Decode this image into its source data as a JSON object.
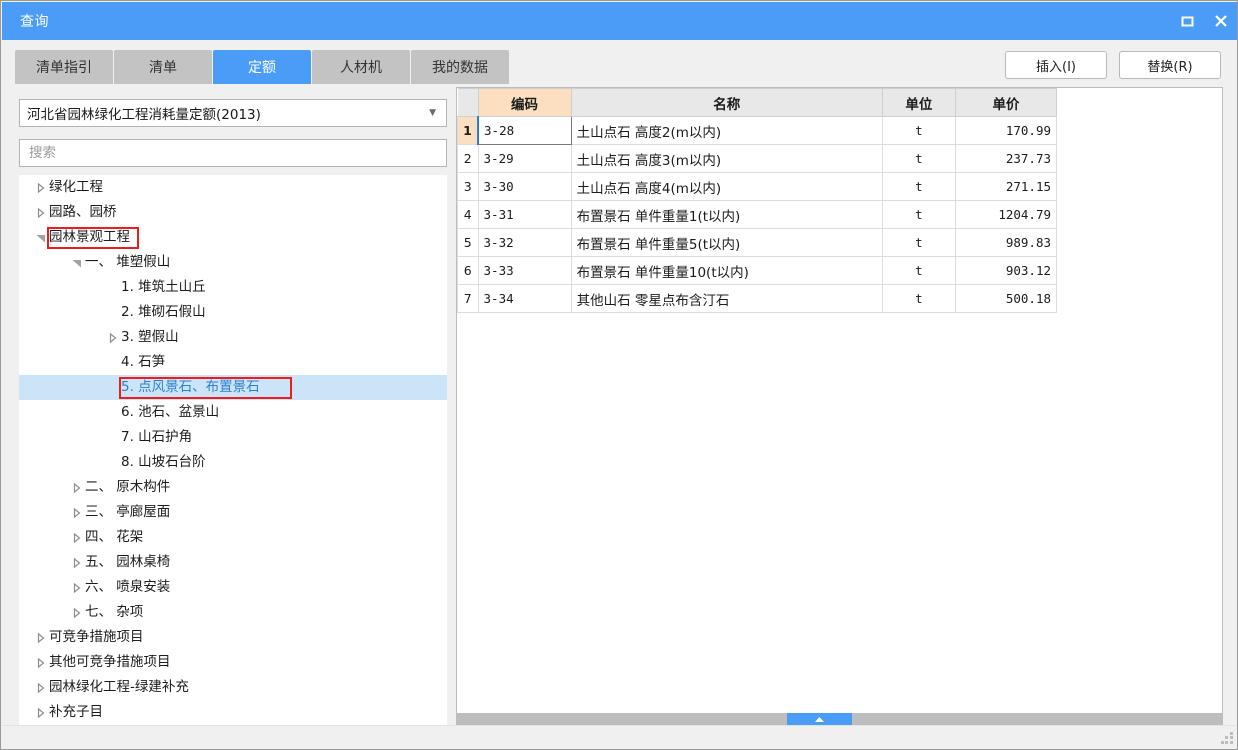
{
  "window": {
    "title": "查询",
    "controls": {
      "maximize": "□",
      "close": "✕"
    }
  },
  "tabs": [
    {
      "label": "清单指引",
      "active": false
    },
    {
      "label": "清单",
      "active": false
    },
    {
      "label": "定额",
      "active": true
    },
    {
      "label": "人材机",
      "active": false
    },
    {
      "label": "我的数据",
      "active": false
    }
  ],
  "actions": {
    "insert_label": "插入(I)",
    "replace_label": "替换(R)"
  },
  "library": {
    "selected": "河北省园林绿化工程消耗量定额(2013)",
    "dropdown_arrow": "▼"
  },
  "search": {
    "value": "",
    "placeholder": "搜索"
  },
  "tree": [
    {
      "label": "绿化工程",
      "indent": 0,
      "state": "collapsed",
      "selected": false,
      "boxed": false
    },
    {
      "label": "园路、园桥",
      "indent": 0,
      "state": "collapsed",
      "selected": false,
      "boxed": false
    },
    {
      "label": "园林景观工程",
      "indent": 0,
      "state": "expanded",
      "selected": false,
      "boxed": true
    },
    {
      "label": "一、 堆塑假山",
      "indent": 1,
      "state": "expanded",
      "selected": false,
      "boxed": false
    },
    {
      "label": "1. 堆筑土山丘",
      "indent": 2,
      "state": "leaf",
      "selected": false,
      "boxed": false
    },
    {
      "label": "2. 堆砌石假山",
      "indent": 2,
      "state": "leaf",
      "selected": false,
      "boxed": false
    },
    {
      "label": "3. 塑假山",
      "indent": 2,
      "state": "collapsed",
      "selected": false,
      "boxed": false
    },
    {
      "label": "4. 石笋",
      "indent": 2,
      "state": "leaf",
      "selected": false,
      "boxed": false
    },
    {
      "label": "5. 点风景石、布置景石",
      "indent": 2,
      "state": "leaf",
      "selected": true,
      "boxed": true
    },
    {
      "label": "6. 池石、盆景山",
      "indent": 2,
      "state": "leaf",
      "selected": false,
      "boxed": false
    },
    {
      "label": "7. 山石护角",
      "indent": 2,
      "state": "leaf",
      "selected": false,
      "boxed": false
    },
    {
      "label": "8. 山坡石台阶",
      "indent": 2,
      "state": "leaf",
      "selected": false,
      "boxed": false
    },
    {
      "label": "二、 原木构件",
      "indent": 1,
      "state": "collapsed",
      "selected": false,
      "boxed": false
    },
    {
      "label": "三、 亭廊屋面",
      "indent": 1,
      "state": "collapsed",
      "selected": false,
      "boxed": false
    },
    {
      "label": "四、 花架",
      "indent": 1,
      "state": "collapsed",
      "selected": false,
      "boxed": false
    },
    {
      "label": "五、 园林桌椅",
      "indent": 1,
      "state": "collapsed",
      "selected": false,
      "boxed": false
    },
    {
      "label": "六、 喷泉安装",
      "indent": 1,
      "state": "collapsed",
      "selected": false,
      "boxed": false
    },
    {
      "label": "七、 杂项",
      "indent": 1,
      "state": "collapsed",
      "selected": false,
      "boxed": false
    },
    {
      "label": "可竞争措施项目",
      "indent": 0,
      "state": "collapsed",
      "selected": false,
      "boxed": false
    },
    {
      "label": "其他可竞争措施项目",
      "indent": 0,
      "state": "collapsed",
      "selected": false,
      "boxed": false
    },
    {
      "label": "园林绿化工程-绿建补充",
      "indent": 0,
      "state": "collapsed",
      "selected": false,
      "boxed": false
    },
    {
      "label": "补充子目",
      "indent": 0,
      "state": "collapsed",
      "selected": false,
      "boxed": false
    }
  ],
  "grid": {
    "headers": {
      "rownum": "",
      "code": "编码",
      "name": "名称",
      "unit": "单位",
      "price": "单价"
    },
    "rows": [
      {
        "n": "1",
        "code": "3-28",
        "name": "土山点石 高度2(m以内)",
        "unit": "t",
        "price": "170.99",
        "active": true
      },
      {
        "n": "2",
        "code": "3-29",
        "name": "土山点石 高度3(m以内)",
        "unit": "t",
        "price": "237.73",
        "active": false
      },
      {
        "n": "3",
        "code": "3-30",
        "name": "土山点石 高度4(m以内)",
        "unit": "t",
        "price": "271.15",
        "active": false
      },
      {
        "n": "4",
        "code": "3-31",
        "name": "布置景石 单件重量1(t以内)",
        "unit": "t",
        "price": "1204.79",
        "active": false
      },
      {
        "n": "5",
        "code": "3-32",
        "name": "布置景石 单件重量5(t以内)",
        "unit": "t",
        "price": "989.83",
        "active": false
      },
      {
        "n": "6",
        "code": "3-33",
        "name": "布置景石 单件重量10(t以内)",
        "unit": "t",
        "price": "903.12",
        "active": false
      },
      {
        "n": "7",
        "code": "3-34",
        "name": "其他山石 零星点布含汀石",
        "unit": "t",
        "price": "500.18",
        "active": false
      }
    ]
  },
  "colors": {
    "accent": "#4a9cf6",
    "tab_inactive": "#c3c3c3",
    "code_header": "#fbdfc0",
    "selection": "#cce4f7",
    "annotation": "#ef1c1c"
  }
}
